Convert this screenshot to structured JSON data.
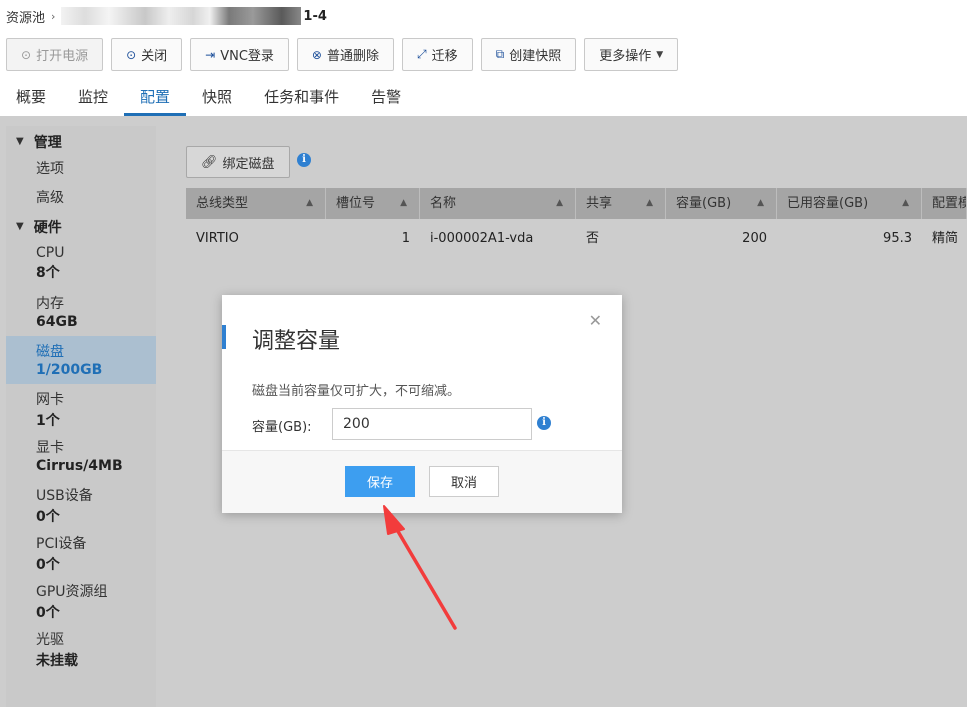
{
  "breadcrumb": {
    "root": "资源池",
    "vm_name": "1-4"
  },
  "toolbar": {
    "power_on": "打开电源",
    "shutdown": "关闭",
    "vnc": "VNC登录",
    "delete": "普通删除",
    "migrate": "迁移",
    "snapshot": "创建快照",
    "more": "更多操作"
  },
  "tabs": [
    "概要",
    "监控",
    "配置",
    "快照",
    "任务和事件",
    "告警"
  ],
  "active_tab": "配置",
  "sidebar": {
    "manage": {
      "label": "管理",
      "items": [
        "选项",
        "高级"
      ]
    },
    "hardware": {
      "label": "硬件",
      "items": [
        {
          "label": "CPU",
          "value": "8个"
        },
        {
          "label": "内存",
          "value": "64GB"
        },
        {
          "label": "磁盘",
          "value": "1/200GB"
        },
        {
          "label": "网卡",
          "value": "1个"
        },
        {
          "label": "显卡",
          "value": "Cirrus/4MB"
        },
        {
          "label": "USB设备",
          "value": "0个"
        },
        {
          "label": "PCI设备",
          "value": "0个"
        },
        {
          "label": "GPU资源组",
          "value": "0个"
        },
        {
          "label": "光驱",
          "value": "未挂载"
        }
      ]
    }
  },
  "content": {
    "bind_disk_label": "绑定磁盘",
    "table": {
      "headers": [
        "总线类型",
        "槽位号",
        "名称",
        "共享",
        "容量(GB)",
        "已用容量(GB)",
        "配置模"
      ],
      "rows": [
        [
          "VIRTIO",
          "1",
          "i-000002A1-vda",
          "否",
          "200",
          "95.3",
          "精简"
        ]
      ]
    }
  },
  "modal": {
    "title": "调整容量",
    "hint": "磁盘当前容量仅可扩大，不可缩减。",
    "field_label": "容量(GB):",
    "field_value": "200",
    "save": "保存",
    "cancel": "取消"
  },
  "colors": {
    "accent": "#2f80d1",
    "save_button": "#3d9ef0",
    "arrow": "#f23c3c"
  }
}
